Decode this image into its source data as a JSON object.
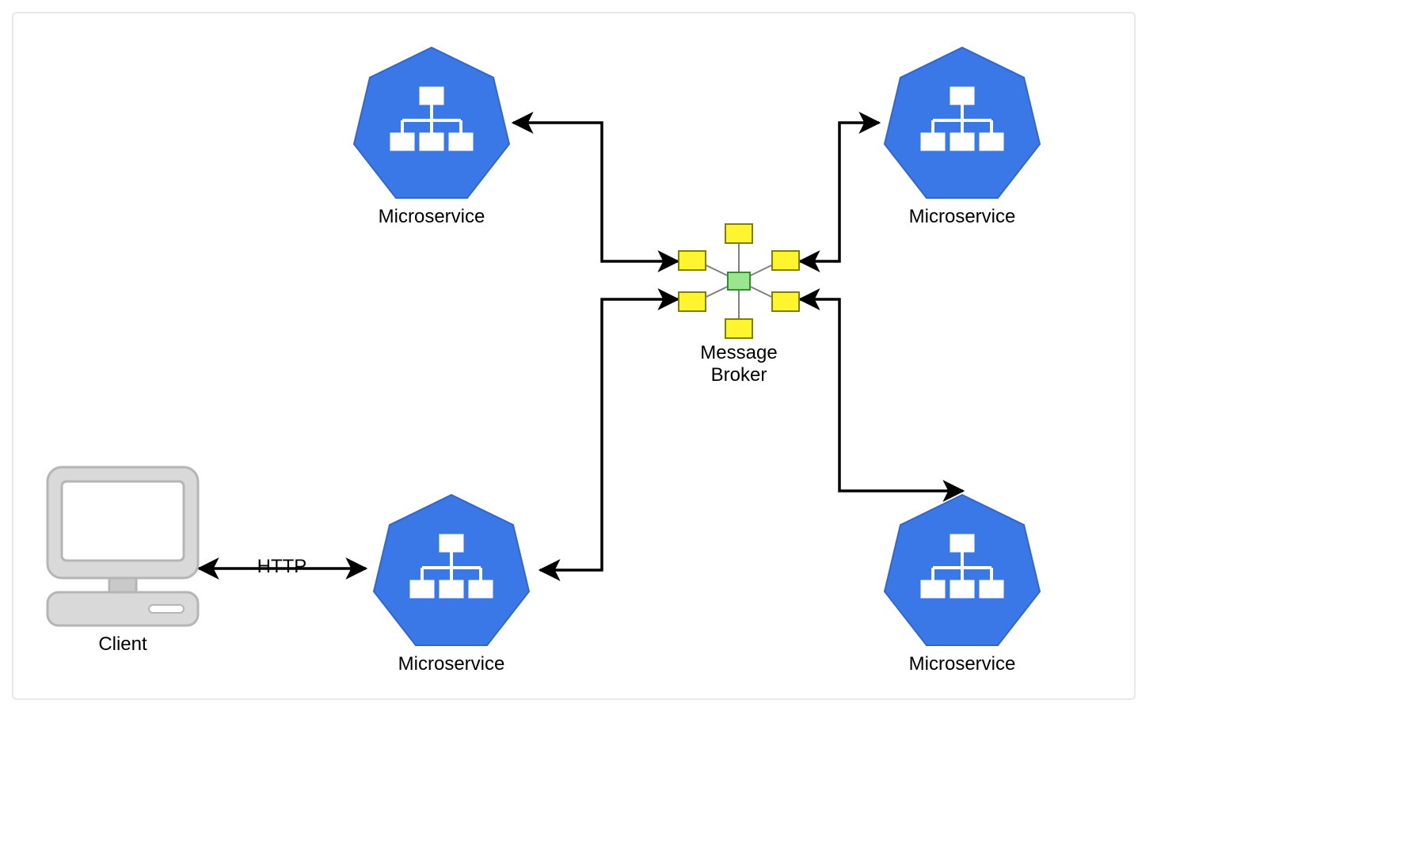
{
  "nodes": {
    "client": {
      "label": "Client"
    },
    "ms_top_left": {
      "label": "Microservice"
    },
    "ms_top_right": {
      "label": "Microservice"
    },
    "ms_bottom_left": {
      "label": "Microservice"
    },
    "ms_bottom_right": {
      "label": "Microservice"
    },
    "broker": {
      "label": "Message\nBroker"
    }
  },
  "edges": {
    "client_to_ms": {
      "label": "HTTP"
    }
  },
  "colors": {
    "service_fill": "#3B78E7",
    "broker_center": "#9AE68F",
    "broker_node": "#FFF52E",
    "stroke": "#000000",
    "client_grey": "#D9D9D9",
    "client_grey_dark": "#C9C9C9"
  }
}
